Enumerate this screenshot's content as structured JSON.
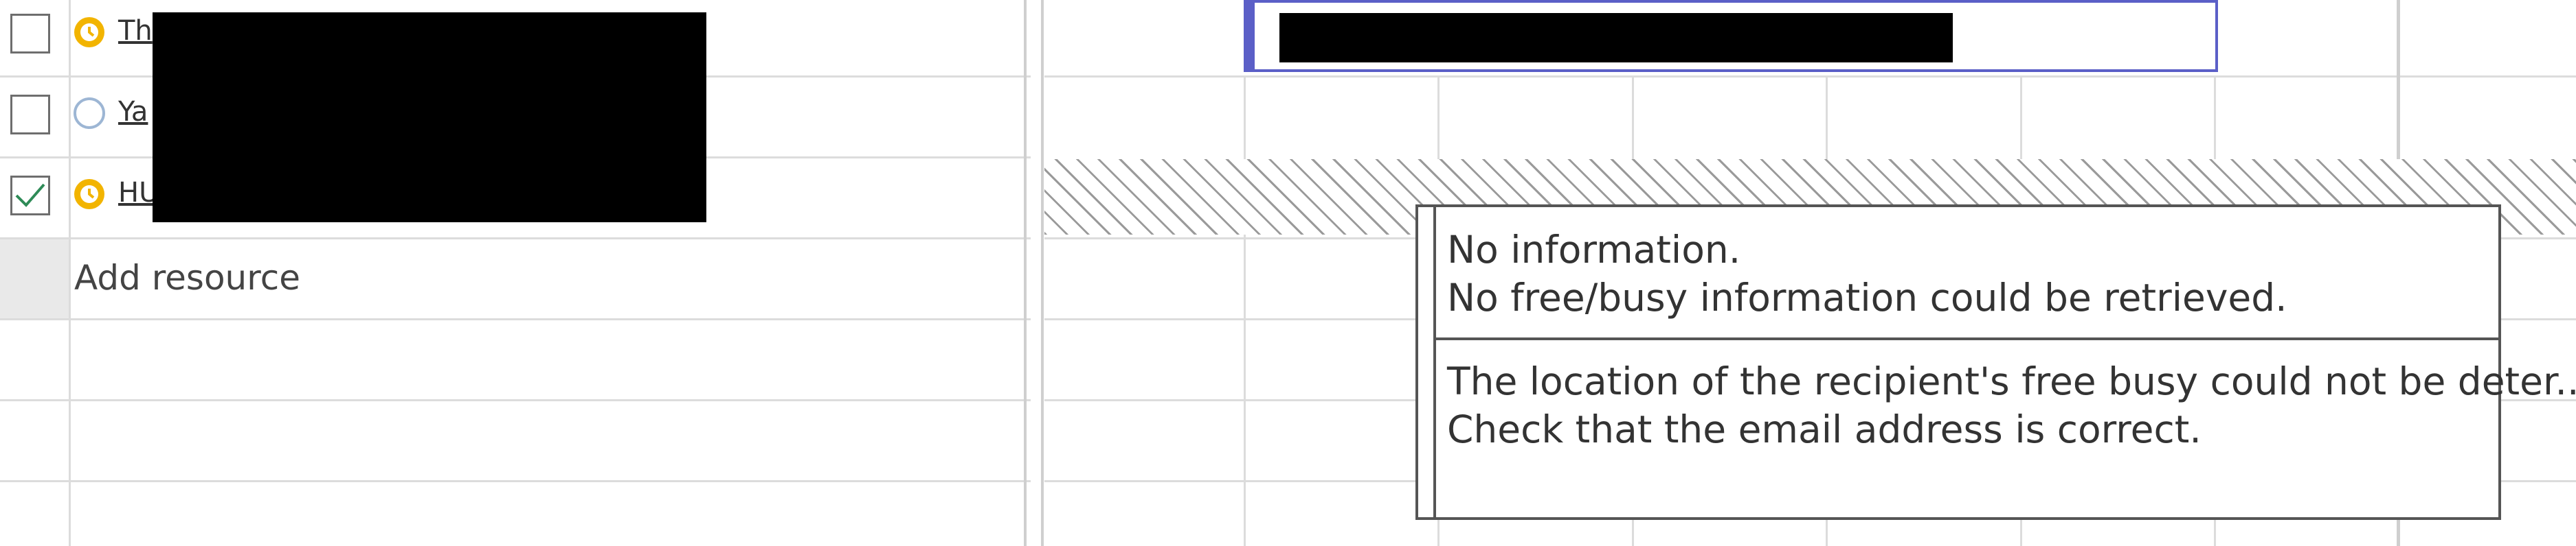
{
  "attendees": [
    {
      "name_visible": "Th",
      "status": "busy-tentative",
      "checked": false
    },
    {
      "name_visible": "Ya",
      "status": "unknown",
      "checked": false
    },
    {
      "name_visible": "HU",
      "status": "busy-tentative",
      "checked": true
    }
  ],
  "add_resource_label": "Add resource",
  "tooltip": {
    "title": "No information.",
    "line1": "No free/busy information could be retrieved.",
    "detail1": "The location of the recipient's free busy could not be deter...",
    "detail2": "Check that the email address is correct."
  },
  "colors": {
    "accent": "#5b5fc7",
    "status_busy": "#f2b400",
    "status_unknown": "#9db6d4",
    "check": "#2e8b57",
    "grid": "#dcdcdc",
    "hatch": "#9a9a9a"
  }
}
